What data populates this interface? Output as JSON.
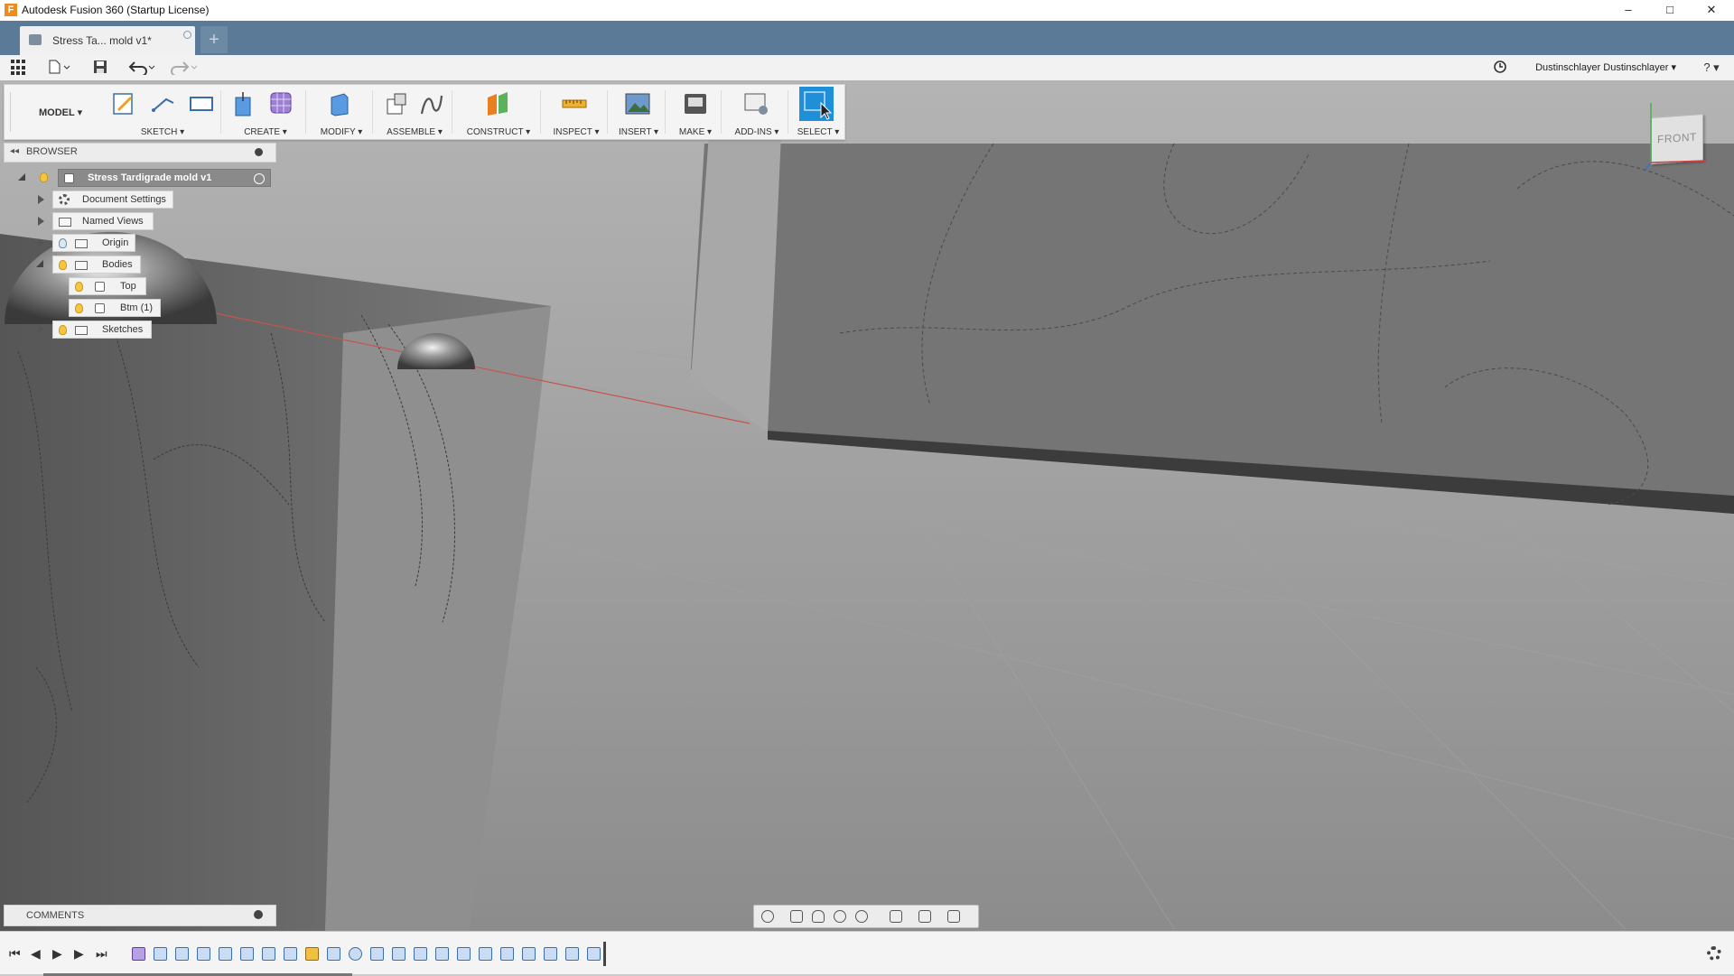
{
  "window": {
    "title": "Autodesk Fusion 360 (Startup License)",
    "controls": {
      "minimize": "–",
      "maximize": "□",
      "close": "✕"
    }
  },
  "tabs": [
    {
      "label": "Stress Ta... mold v1*",
      "active": true
    }
  ],
  "new_tab_label": "+",
  "user": {
    "name": "Dustinschlayer Dustinschlayer ▾",
    "help": "? ▾"
  },
  "toolbar": {
    "workspace": "MODEL ▾",
    "groups": [
      {
        "label": "SKETCH ▾"
      },
      {
        "label": "CREATE ▾"
      },
      {
        "label": "MODIFY ▾"
      },
      {
        "label": "ASSEMBLE ▾"
      },
      {
        "label": "CONSTRUCT ▾"
      },
      {
        "label": "INSPECT ▾"
      },
      {
        "label": "INSERT ▾"
      },
      {
        "label": "MAKE ▾"
      },
      {
        "label": "ADD-INS ▾"
      },
      {
        "label": "SELECT ▾"
      }
    ]
  },
  "browser": {
    "title": "BROWSER",
    "root": "Stress Tardigrade mold v1",
    "items": [
      {
        "label": "Document Settings"
      },
      {
        "label": "Named Views"
      },
      {
        "label": "Origin"
      },
      {
        "label": "Bodies"
      },
      {
        "label": "Top"
      },
      {
        "label": "Btm (1)"
      },
      {
        "label": "Sketches"
      }
    ]
  },
  "viewcube": {
    "face": "FRONT"
  },
  "comments": {
    "title": "COMMENTS"
  },
  "colors": {
    "tabstrip": "#5a7a97",
    "select_active": "#1f8fd8",
    "viewport": "#8a8a8a",
    "bulb_on": "#f6c543"
  }
}
